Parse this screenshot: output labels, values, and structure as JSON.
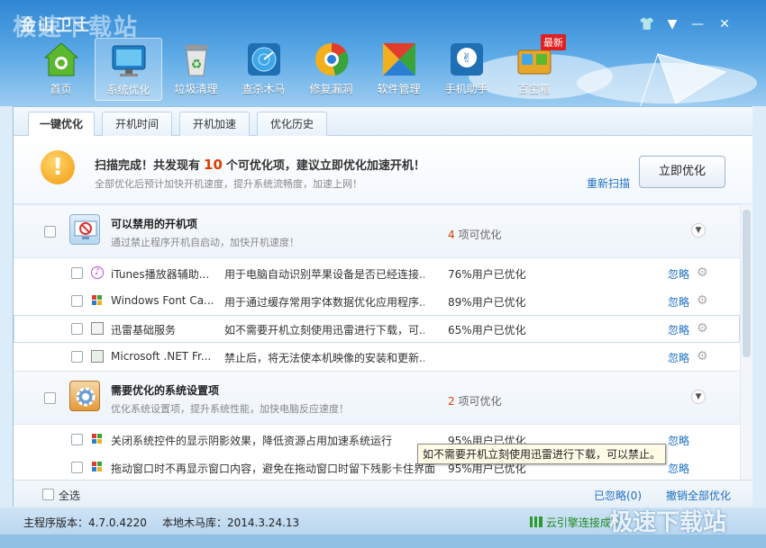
{
  "window": {
    "title": "金山卫士",
    "watermark_top": "极速下载站",
    "watermark_bottom": "极速下载站"
  },
  "controls": {
    "skin": "👕",
    "menu": "▼",
    "minimize": "—",
    "close": "✕"
  },
  "toolbar": [
    {
      "label": "首页",
      "icon": "home-icon"
    },
    {
      "label": "系统优化",
      "icon": "monitor-icon"
    },
    {
      "label": "垃圾清理",
      "icon": "recycle-bin-icon"
    },
    {
      "label": "查杀木马",
      "icon": "radar-icon"
    },
    {
      "label": "修复漏洞",
      "icon": "chrome-shield-icon"
    },
    {
      "label": "软件管理",
      "icon": "software-icon"
    },
    {
      "label": "手机助手",
      "icon": "phone-icon"
    },
    {
      "label": "百宝箱",
      "icon": "toolbox-icon",
      "badge": "最新"
    }
  ],
  "tabs": [
    "一键优化",
    "开机时间",
    "开机加速",
    "优化历史"
  ],
  "summary": {
    "prefix": "扫描完成！共发现有",
    "count": "10",
    "suffix": "个可优化项，建议立即优化加速开机！",
    "sub": "全部优化后预计加快开机速度，提升系统流畅度，加速上网！",
    "rescan": "重新扫描",
    "optimize": "立即优化"
  },
  "groups": [
    {
      "title": "可以禁用的开机项",
      "sub": "通过禁止程序开机自启动，加快开机速度！",
      "count": "4",
      "count_suffix": "项可优化"
    },
    {
      "title": "需要优化的系统设置项",
      "sub": "优化系统设置项，提升系统性能，加快电脑反应速度！",
      "count": "2",
      "count_suffix": "项可优化"
    }
  ],
  "rows": [
    {
      "name": "iTunes播放器辅助...",
      "desc": "用于电脑自动识别苹果设备是否已经连接...",
      "pct": "76%用户已优化",
      "ignore": "忽略"
    },
    {
      "name": "Windows Font Ca...",
      "desc": "用于通过缓存常用字体数据优化应用程序...",
      "pct": "89%用户已优化",
      "ignore": "忽略"
    },
    {
      "name": "迅雷基础服务",
      "desc": "如不需要开机立刻使用迅雷进行下载，可...",
      "pct": "65%用户已优化",
      "ignore": "忽略"
    },
    {
      "name": "Microsoft .NET Fr...",
      "desc": "禁止后，将无法使本机映像的安装和更新...",
      "pct": "",
      "ignore": "忽略"
    }
  ],
  "rows2": [
    {
      "desc": "关闭系统控件的显示阴影效果，降低资源占用加速系统运行",
      "pct": "95%用户已优化",
      "ignore": "忽略"
    },
    {
      "desc": "拖动窗口时不再显示窗口内容，避免在拖动窗口时留下残影卡住界面",
      "pct": "95%用户已优化",
      "ignore": "忽略"
    }
  ],
  "tooltip": "如不需要开机立刻使用迅雷进行下载，可以禁止。",
  "footer": {
    "select_all": "全选",
    "ignored": "已忽略(0)",
    "undo": "撤销全部优化"
  },
  "status": {
    "version": "主程序版本：4.7.0.4220",
    "virus_db": "本地木马库：2014.3.24.13",
    "cloud": "云引擎连接成功"
  }
}
